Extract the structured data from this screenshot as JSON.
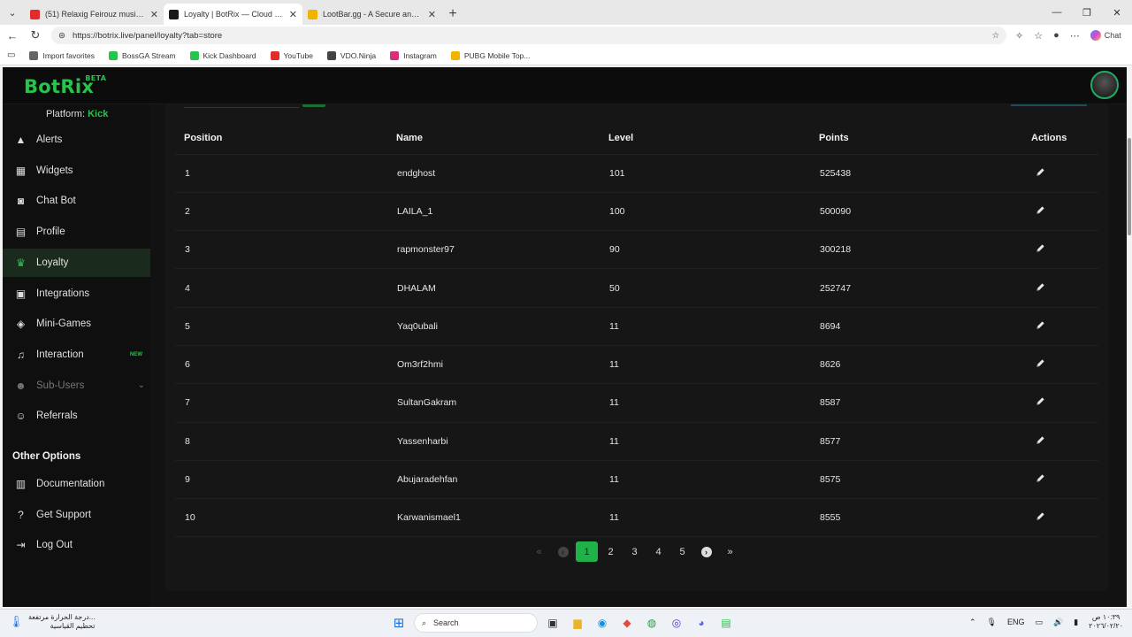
{
  "browser": {
    "tabs": [
      {
        "title": "(51) Relaxig Feirouz music Sno",
        "active": false,
        "color": "#e32b2b"
      },
      {
        "title": "Loyalty | BotRix — Cloud Streamin",
        "active": true,
        "color": "#1a1a1a"
      },
      {
        "title": "LootBar.gg - A Secure and Afforda",
        "active": false,
        "color": "#f0b400"
      }
    ],
    "url": "https://botrix.live/panel/loyalty?tab=store",
    "chat_label": "Chat",
    "bookmarks": [
      {
        "label": "Import favorites",
        "color": "#666"
      },
      {
        "label": "BossGA Stream",
        "color": "#27c44c"
      },
      {
        "label": "Kick Dashboard",
        "color": "#27c44c"
      },
      {
        "label": "YouTube",
        "color": "#e32b2b"
      },
      {
        "label": "VDO.Ninja",
        "color": "#444"
      },
      {
        "label": "Instagram",
        "color": "#d6307c"
      },
      {
        "label": "PUBG Mobile Top...",
        "color": "#f0b400"
      }
    ]
  },
  "app": {
    "logo": "BotRix",
    "logo_badge": "BETA",
    "accent": "#27c44c",
    "platform_label": "Platform:",
    "platform_value": "Kick",
    "sidebar": [
      {
        "label": "Alerts",
        "icon": "warning-icon"
      },
      {
        "label": "Widgets",
        "icon": "widgets-icon"
      },
      {
        "label": "Chat Bot",
        "icon": "robot-icon"
      },
      {
        "label": "Profile",
        "icon": "id-card-icon"
      },
      {
        "label": "Loyalty",
        "icon": "trophy-icon",
        "active": true
      },
      {
        "label": "Integrations",
        "icon": "plug-icon"
      },
      {
        "label": "Mini-Games",
        "icon": "gamepad-icon"
      },
      {
        "label": "Interaction",
        "icon": "music-icon",
        "badge": "NEW"
      },
      {
        "label": "Sub-Users",
        "icon": "users-icon",
        "dim": true,
        "chevron": true
      },
      {
        "label": "Referrals",
        "icon": "user-group-icon"
      }
    ],
    "other_options_title": "Other Options",
    "other_options": [
      {
        "label": "Documentation",
        "icon": "book-icon"
      },
      {
        "label": "Get Support",
        "icon": "question-icon"
      },
      {
        "label": "Log Out",
        "icon": "logout-icon"
      }
    ]
  },
  "table": {
    "headers": [
      "Position",
      "Name",
      "Level",
      "Points",
      "Actions"
    ],
    "rows": [
      [
        "1",
        "endghost",
        "101",
        "525438"
      ],
      [
        "2",
        "LAILA_1",
        "100",
        "500090"
      ],
      [
        "3",
        "rapmonster97",
        "90",
        "300218"
      ],
      [
        "4",
        "DHALAM",
        "50",
        "252747"
      ],
      [
        "5",
        "Yaq0ubali",
        "11",
        "8694"
      ],
      [
        "6",
        "Om3rf2hmi",
        "11",
        "8626"
      ],
      [
        "7",
        "SultanGakram",
        "11",
        "8587"
      ],
      [
        "8",
        "Yassenharbi",
        "11",
        "8577"
      ],
      [
        "9",
        "Abujaradehfan",
        "11",
        "8575"
      ],
      [
        "10",
        "Karwanismael1",
        "11",
        "8555"
      ]
    ]
  },
  "pagination": {
    "pages": [
      "1",
      "2",
      "3",
      "4",
      "5"
    ],
    "current": "1",
    "first": "«",
    "prev": "‹",
    "next": "›",
    "last": "»"
  },
  "taskbar": {
    "weather_line1": "درجة الحرارة مرتفعة...",
    "weather_line2": "تحطيم القياسية",
    "search_label": "Search",
    "lang": "ENG",
    "time": "١٠:٣٩ ص",
    "date": "٢٠٢٦/٠٢/٢٠"
  }
}
